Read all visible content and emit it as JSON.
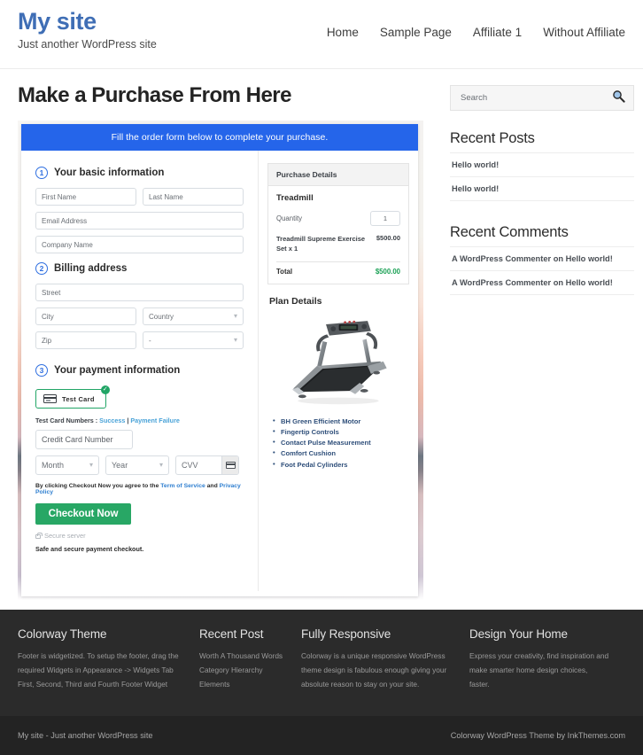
{
  "header": {
    "site_title": "My site",
    "tagline": "Just another WordPress site",
    "nav": [
      {
        "label": "Home"
      },
      {
        "label": "Sample Page"
      },
      {
        "label": "Affiliate 1"
      },
      {
        "label": "Without Affiliate"
      }
    ]
  },
  "main": {
    "page_title": "Make a Purchase From Here",
    "banner": "Fill the order form below to complete your purchase.",
    "steps": {
      "one_num": "1",
      "one_label": "Your basic information",
      "two_num": "2",
      "two_label": "Billing address",
      "three_num": "3",
      "three_label": "Your payment information"
    },
    "fields": {
      "first_name": "First Name",
      "last_name": "Last Name",
      "email": "Email Address",
      "company": "Company Name",
      "street": "Street",
      "city": "City",
      "country": "Country",
      "zip": "Zip",
      "state": "-",
      "credit_card": "Credit Card Number",
      "month": "Month",
      "year": "Year",
      "cvv": "CVV"
    },
    "payment": {
      "method_label": "Test  Card",
      "check_mark": "✓",
      "test_card_prefix": "Test Card Numbers : ",
      "test_card_success": "Success",
      "test_card_divider": " | ",
      "test_card_failure": "Payment Failure",
      "terms_prefix": "By clicking Checkout Now you agree to the ",
      "terms_link1": "Term of Service",
      "terms_mid": " and ",
      "terms_link2": "Privacy Policy",
      "checkout_label": "Checkout Now",
      "secure_server": "Secure server",
      "safe_note": "Safe and secure payment checkout."
    },
    "purchase_details": {
      "panel_title": "Purchase Details",
      "product": "Treadmill",
      "quantity_label": "Quantity",
      "quantity_value": "1",
      "item_name": "Treadmill Supreme Exercise Set x 1",
      "item_price": "$500.00",
      "total_label": "Total",
      "total_value": "$500.00"
    },
    "plan": {
      "title": "Plan Details",
      "image_alt": "treadmill-product-image",
      "features": [
        "BH Green Efficient Motor",
        "Fingertip Controls",
        "Contact Pulse Measurement",
        "Comfort Cushion",
        "Foot Pedal Cylinders"
      ]
    }
  },
  "sidebar": {
    "search_placeholder": "Search",
    "recent_posts_title": "Recent Posts",
    "recent_posts": [
      {
        "label": "Hello world!"
      },
      {
        "label": "Hello world!"
      }
    ],
    "recent_comments_title": "Recent Comments",
    "recent_comments": [
      {
        "label": "A WordPress Commenter on Hello world!"
      },
      {
        "label": "A WordPress Commenter on Hello world!"
      }
    ]
  },
  "footer": {
    "columns": [
      {
        "heading": "Colorway Theme",
        "text": "Footer is widgetized. To setup the footer, drag the required Widgets in Appearance -> Widgets Tab First, Second, Third and Fourth Footer Widget"
      },
      {
        "heading": "Recent Post",
        "items": [
          {
            "label": "Worth A Thousand Words"
          },
          {
            "label": "Category Hierarchy"
          },
          {
            "label": "Elements"
          }
        ]
      },
      {
        "heading": "Fully Responsive",
        "text": "Colorway is a unique responsive WordPress theme design is fabulous enough giving your absolute reason to stay on your site."
      },
      {
        "heading": "Design Your Home",
        "text": "Express your creativity, find inspiration and make smarter home design choices, faster."
      }
    ],
    "bottom_left": "My site - Just another WordPress site",
    "bottom_right": "Colorway WordPress Theme by InkThemes.com"
  },
  "colors": {
    "brand_blue": "#3f6eb5",
    "banner_blue": "#2565ea",
    "accent_green": "#28a765",
    "total_green": "#1aa055",
    "footer_bg": "#2b2b2b",
    "footer_bottom_bg": "#232323"
  }
}
